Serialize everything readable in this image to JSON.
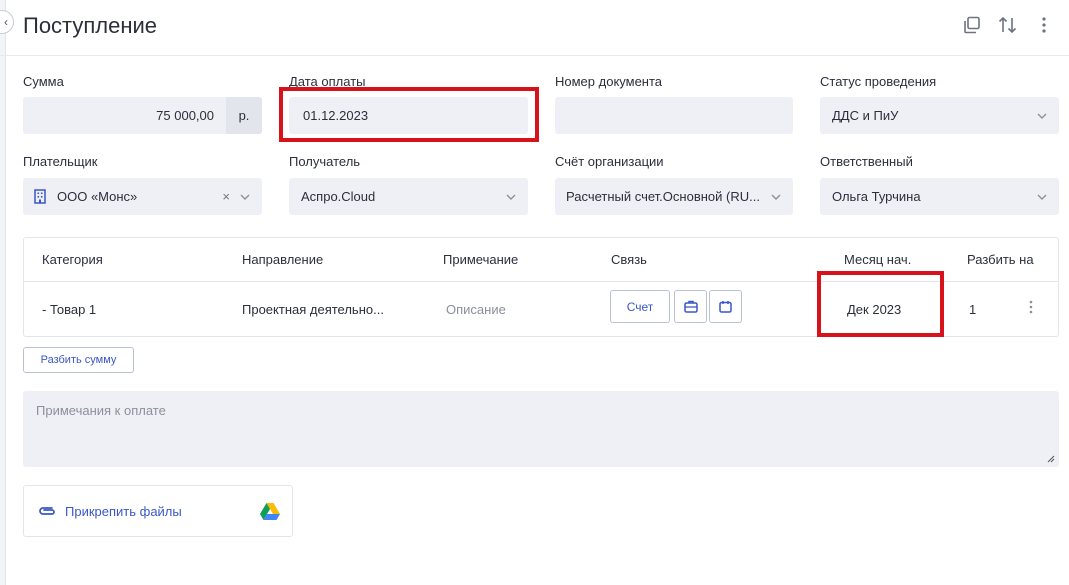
{
  "header": {
    "title": "Поступление",
    "icons": [
      "copy-icon",
      "sort-icon",
      "more-vertical-icon"
    ]
  },
  "fields": {
    "amount": {
      "label": "Сумма",
      "value": "75 000,00",
      "unit": "р."
    },
    "payment_date": {
      "label": "Дата оплаты",
      "value": "01.12.2023"
    },
    "doc_number": {
      "label": "Номер документа",
      "value": ""
    },
    "posting_status": {
      "label": "Статус проведения",
      "value": "ДДС и ПиУ"
    },
    "payer": {
      "label": "Плательщик",
      "value": "ООО «Монс»"
    },
    "recipient": {
      "label": "Получатель",
      "value": "Аспро.Cloud"
    },
    "org_account": {
      "label": "Счёт организации",
      "value": "Расчетный счет.Основной (RU..."
    },
    "responsible": {
      "label": "Ответственный",
      "value": "Ольга Турчина"
    }
  },
  "table": {
    "headers": [
      "Категория",
      "Направление",
      "Примечание",
      "Связь",
      "Месяц нач.",
      "Разбить на"
    ],
    "rows": [
      {
        "category": "- Товар 1",
        "direction": "Проектная деятельно...",
        "note": "Описание",
        "link_button": "Счет",
        "month": "Дек 2023",
        "split": "1"
      }
    ]
  },
  "split_button": "Разбить сумму",
  "notes": {
    "placeholder": "Примечания к оплате"
  },
  "attach": {
    "label": "Прикрепить файлы"
  },
  "colors": {
    "accent": "#3a57c7",
    "highlight": "#d8121b",
    "field_bg": "#eef0f5"
  }
}
